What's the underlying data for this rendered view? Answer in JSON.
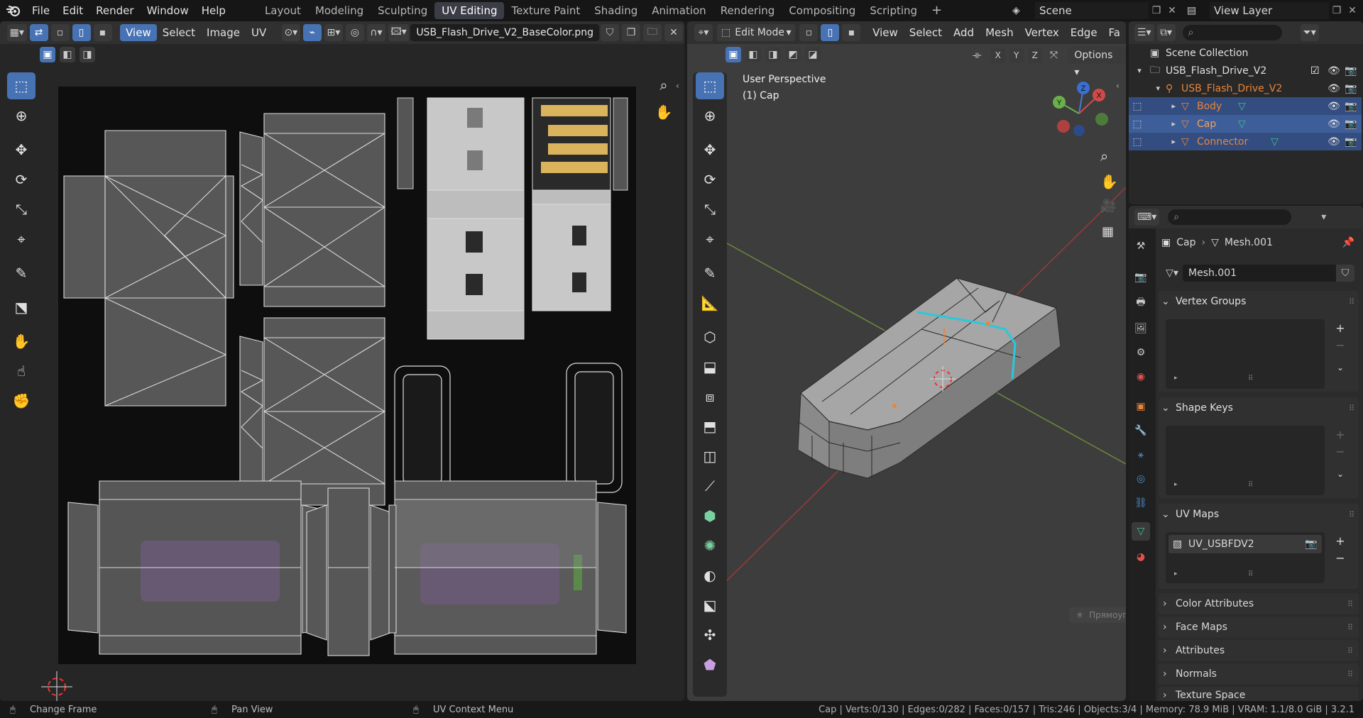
{
  "topbar": {
    "menus": [
      "File",
      "Edit",
      "Render",
      "Window",
      "Help"
    ],
    "workspaces": [
      "Layout",
      "Modeling",
      "Sculpting",
      "UV Editing",
      "Texture Paint",
      "Shading",
      "Animation",
      "Rendering",
      "Compositing",
      "Scripting"
    ],
    "active_workspace": "UV Editing",
    "add_tab": "+",
    "scene": "Scene",
    "view_layer": "View Layer"
  },
  "uv_editor": {
    "header_menus": [
      "View",
      "Select",
      "Image",
      "UV"
    ],
    "active_menu": "View",
    "image_name": "USB_Flash_Drive_V2_BaseColor.png"
  },
  "viewport": {
    "mode": "Edit Mode",
    "menus": [
      "View",
      "Select",
      "Add",
      "Mesh",
      "Vertex",
      "Edge",
      "Fa"
    ],
    "axes": [
      "X",
      "Y",
      "Z"
    ],
    "options": "Options",
    "perspective": "User Perspective",
    "object_label": "(1) Cap",
    "gizmo": {
      "x": "X",
      "y": "Y",
      "z": "Z"
    },
    "tooltip": "Прямоугольник"
  },
  "outliner": {
    "scene_collection": "Scene Collection",
    "collection": "USB_Flash_Drive_V2",
    "object": "USB_Flash_Drive_V2",
    "children": [
      "Body",
      "Cap",
      "Connector"
    ],
    "selected": "Cap"
  },
  "properties": {
    "breadcrumb_object": "Cap",
    "breadcrumb_mesh": "Mesh.001",
    "mesh_name": "Mesh.001",
    "panels": {
      "vertex_groups": "Vertex Groups",
      "shape_keys": "Shape Keys",
      "uv_maps": "UV Maps",
      "uv_map_item": "UV_USBFDV2",
      "collapsed": [
        "Color Attributes",
        "Face Maps",
        "Attributes",
        "Normals",
        "Texture Space"
      ]
    }
  },
  "statusbar": {
    "left": [
      "Change Frame",
      "Pan View",
      "UV Context Menu"
    ],
    "stats": "Cap | Verts:0/130 | Edges:0/282 | Faces:0/157 | Tris:246 | Objects:3/4 | Memory: 78.9 MiB | VRAM: 1.1/8.0 GiB | 3.2.1"
  },
  "colors": {
    "accent": "#4772b3",
    "object_orange": "#e8853a",
    "seam_cyan": "#29c9d9",
    "gold_contact": "#d9b45c"
  }
}
